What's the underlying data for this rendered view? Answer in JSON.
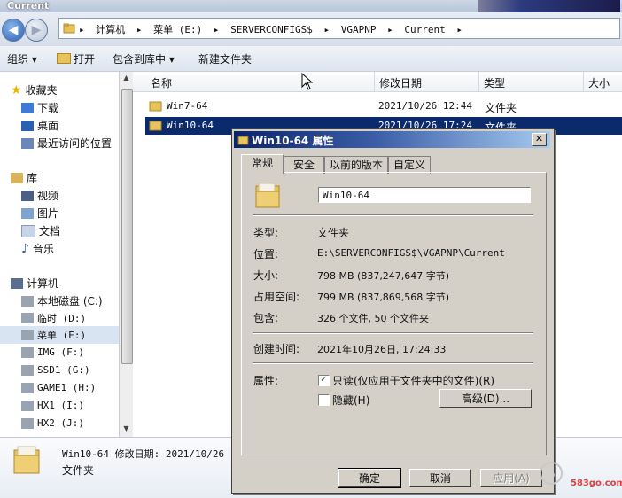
{
  "window": {
    "title": "Current"
  },
  "address": {
    "crumbs": [
      "计算机",
      "菜单 (E:)",
      "SERVERCONFIGS$",
      "VGAPNP",
      "Current"
    ]
  },
  "toolbar": {
    "organize": "组织",
    "open": "打开",
    "include_library": "包含到库中",
    "new_folder": "新建文件夹"
  },
  "nav": {
    "favorites": "收藏夹",
    "downloads": "下载",
    "desktop": "桌面",
    "recent": "最近访问的位置",
    "libraries": "库",
    "videos": "视频",
    "pictures": "图片",
    "documents": "文档",
    "music": "音乐",
    "computer": "计算机",
    "drives": [
      "本地磁盘 (C:)",
      "临时 (D:)",
      "菜单 (E:)",
      "IMG (F:)",
      "SSD1 (G:)",
      "GAME1 (H:)",
      "HX1 (I:)",
      "HX2 (J:)"
    ]
  },
  "columns": {
    "name": "名称",
    "date": "修改日期",
    "type": "类型",
    "size": "大小"
  },
  "files": [
    {
      "name": "Win7-64",
      "date": "2021/10/26 12:44",
      "type": "文件夹"
    },
    {
      "name": "Win10-64",
      "date": "2021/10/26 17:24",
      "type": "文件夹"
    }
  ],
  "details": {
    "line1": "Win10-64  修改日期: 2021/10/26 1",
    "line2": "文件夹"
  },
  "dialog": {
    "title": "Win10-64 属性",
    "tabs": [
      "常规",
      "安全",
      "以前的版本",
      "自定义"
    ],
    "folder_name": "Win10-64",
    "type_label": "类型:",
    "type_value": "文件夹",
    "location_label": "位置:",
    "location_value": "E:\\SERVERCONFIGS$\\VGAPNP\\Current",
    "size_label": "大小:",
    "size_value": "798 MB (837,247,647 字节)",
    "disk_label": "占用空间:",
    "disk_value": "799 MB (837,869,568 字节)",
    "contains_label": "包含:",
    "contains_value": "326 个文件, 50 个文件夹",
    "created_label": "创建时间:",
    "created_value": "2021年10月26日, 17:24:33",
    "attributes_label": "属性:",
    "readonly": "只读(仅应用于文件夹中的文件)(R)",
    "hidden": "隐藏(H)",
    "advanced": "高级(D)...",
    "ok": "确定",
    "cancel": "取消",
    "apply": "应用(A)"
  },
  "watermark": {
    "text": "583go.com"
  },
  "colors": {
    "selection": "#0a2a6c",
    "dialog_bg": "#d4d0c8",
    "title_start": "#0a246a"
  }
}
